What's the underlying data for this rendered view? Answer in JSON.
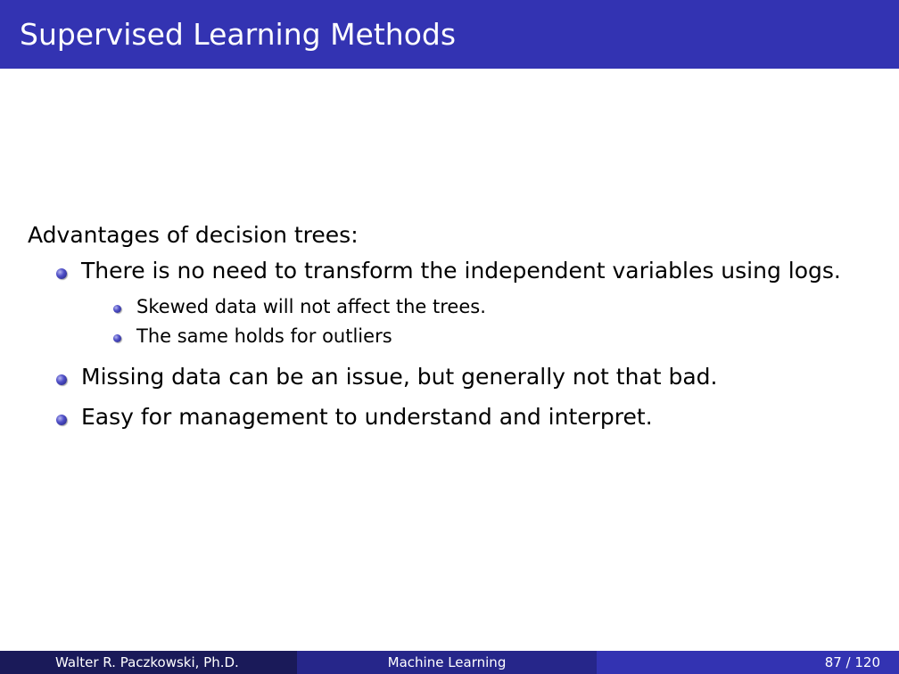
{
  "slide": {
    "title": "Supervised Learning Methods",
    "intro": "Advantages of decision trees:",
    "items": [
      {
        "text": "There is no need to transform the independent variables using logs.",
        "subitems": [
          "Skewed data will not affect the trees.",
          "The same holds for outliers"
        ]
      },
      {
        "text": "Missing data can be an issue, but generally not that bad."
      },
      {
        "text": "Easy for management to understand and interpret."
      }
    ]
  },
  "footer": {
    "author": "Walter R. Paczkowski, Ph.D.",
    "course": "Machine Learning",
    "page": "87 / 120"
  },
  "colors": {
    "title_bar": "#3333b2",
    "footer_left": "#1a1a59",
    "footer_mid": "#26268a",
    "footer_right": "#3333b2"
  }
}
